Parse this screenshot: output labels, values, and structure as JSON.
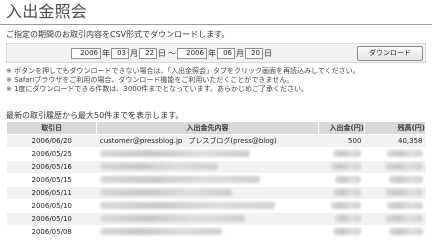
{
  "page": {
    "title": "入出金照会",
    "intro": "ご指定の期間のお取引内容をCSV形式でダウンロードします。"
  },
  "date_range": {
    "start_year": "2006",
    "start_year_suffix": "年",
    "start_month": "03",
    "start_month_suffix": "月",
    "start_day": "22",
    "start_day_suffix": "日",
    "range_separator": "～",
    "end_year": "2006",
    "end_year_suffix": "年",
    "end_month": "06",
    "end_month_suffix": "月",
    "end_day": "20",
    "end_day_suffix": "日",
    "download_button": "ダウンロード"
  },
  "notes": [
    "※ ボタンを押してもダウンロードできない場合は、「入出金照会」タブをクリック画面を再読込みしてください。",
    "※ Safariブラウザをご利用の場合、ダウンロード機能をご利用いただくことができません。",
    "※ 1度にダウンロードできる件数は、3000件までとなっています。あらかじめご了承ください。"
  ],
  "history": {
    "label": "最新の取引履歴から最大50件までを表示します。",
    "headers": {
      "date": "取引日",
      "detail": "入出金先内容",
      "deposit": "入出金(円)",
      "balance": "残高(円)"
    },
    "rows": [
      {
        "date": "2006/06/20",
        "detail_email": "customer@pressblog.jp",
        "detail_name": "プレスブログ(press@blog)",
        "amount": "500",
        "balance": "40,358",
        "blurred": false
      },
      {
        "date": "2006/05/25",
        "blurred": true
      },
      {
        "date": "2006/05/16",
        "blurred": true
      },
      {
        "date": "2006/05/15",
        "blurred": true
      },
      {
        "date": "2006/05/11",
        "blurred": true
      },
      {
        "date": "2006/05/10",
        "blurred": true
      },
      {
        "date": "2006/05/10",
        "blurred": true
      },
      {
        "date": "2006/05/08",
        "blurred": true
      }
    ]
  }
}
